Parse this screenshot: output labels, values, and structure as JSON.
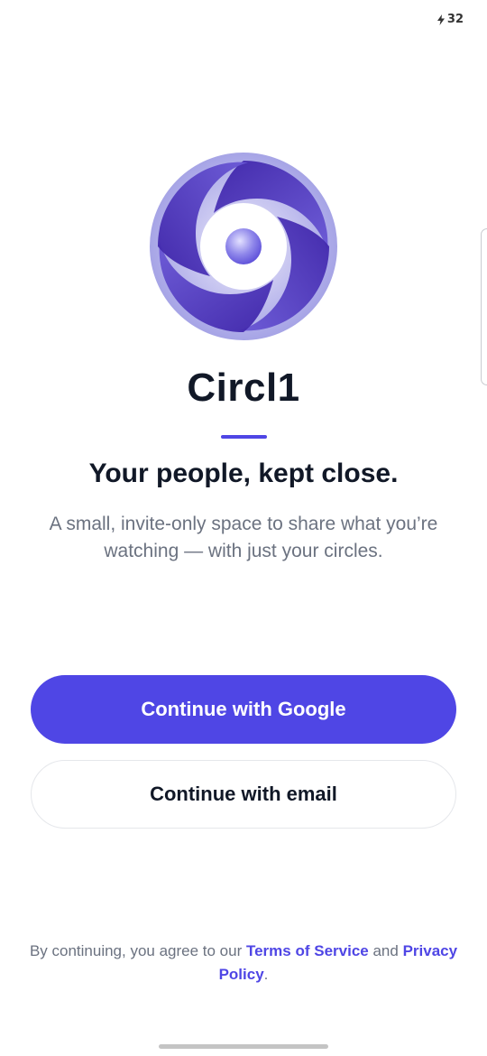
{
  "status_bar": {
    "battery_level": "32",
    "battery_icon": "lightning-bolt-icon"
  },
  "app": {
    "logo_icon": "swirl-logo-icon",
    "name": "Circl1",
    "tagline": "Your people, kept close.",
    "description": "A small, invite-only space to share what you’re watching — with just your circles."
  },
  "actions": {
    "google_label": "Continue with Google",
    "email_label": "Continue with email"
  },
  "legal": {
    "prefix": "By continuing, you agree to our ",
    "terms_label": "Terms of Service",
    "conjunction": " and ",
    "privacy_label": "Privacy Policy",
    "suffix": "."
  },
  "colors": {
    "accent": "#4f46e5",
    "title_text": "#111827",
    "muted_text": "#6b7280",
    "logo_dark": "#4a2fb0",
    "logo_light": "#a6a4e6"
  }
}
